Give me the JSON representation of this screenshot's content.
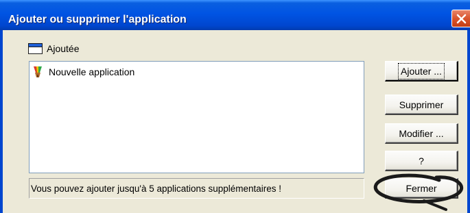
{
  "window": {
    "title": "Ajouter ou supprimer l'application"
  },
  "group": {
    "label": "Ajoutée",
    "icon": "window-icon"
  },
  "list": {
    "items": [
      {
        "label": "Nouvelle application",
        "icon": "application-icon"
      }
    ]
  },
  "status": {
    "text": "Vous pouvez ajouter jusqu'à 5 applications supplémentaires !"
  },
  "buttons": {
    "add": "Ajouter ...",
    "delete": "Supprimer",
    "modify": "Modifier ...",
    "help": "?",
    "close": "Fermer"
  },
  "colors": {
    "titlebar": "#0054e3",
    "close_button": "#d9542c",
    "dialog_background": "#ece9d8",
    "annotation_stroke": "#1a1a1a"
  }
}
